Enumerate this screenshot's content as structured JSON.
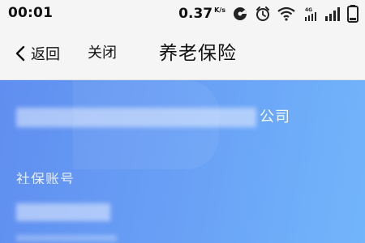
{
  "status_bar": {
    "time": "00:01",
    "net_speed_value": "0.37",
    "net_speed_unit": "K/s",
    "signal_label": "4G",
    "icons": [
      "notification-icon",
      "alarm-icon",
      "wifi-icon",
      "signal-4g-icon",
      "signal-icon",
      "battery-icon"
    ]
  },
  "nav": {
    "back_label": "返回",
    "close_label": "关闭",
    "title": "养老保险"
  },
  "card": {
    "company_suffix": "公司",
    "account_label": "社保账号",
    "accent": "#6aa2f6"
  }
}
